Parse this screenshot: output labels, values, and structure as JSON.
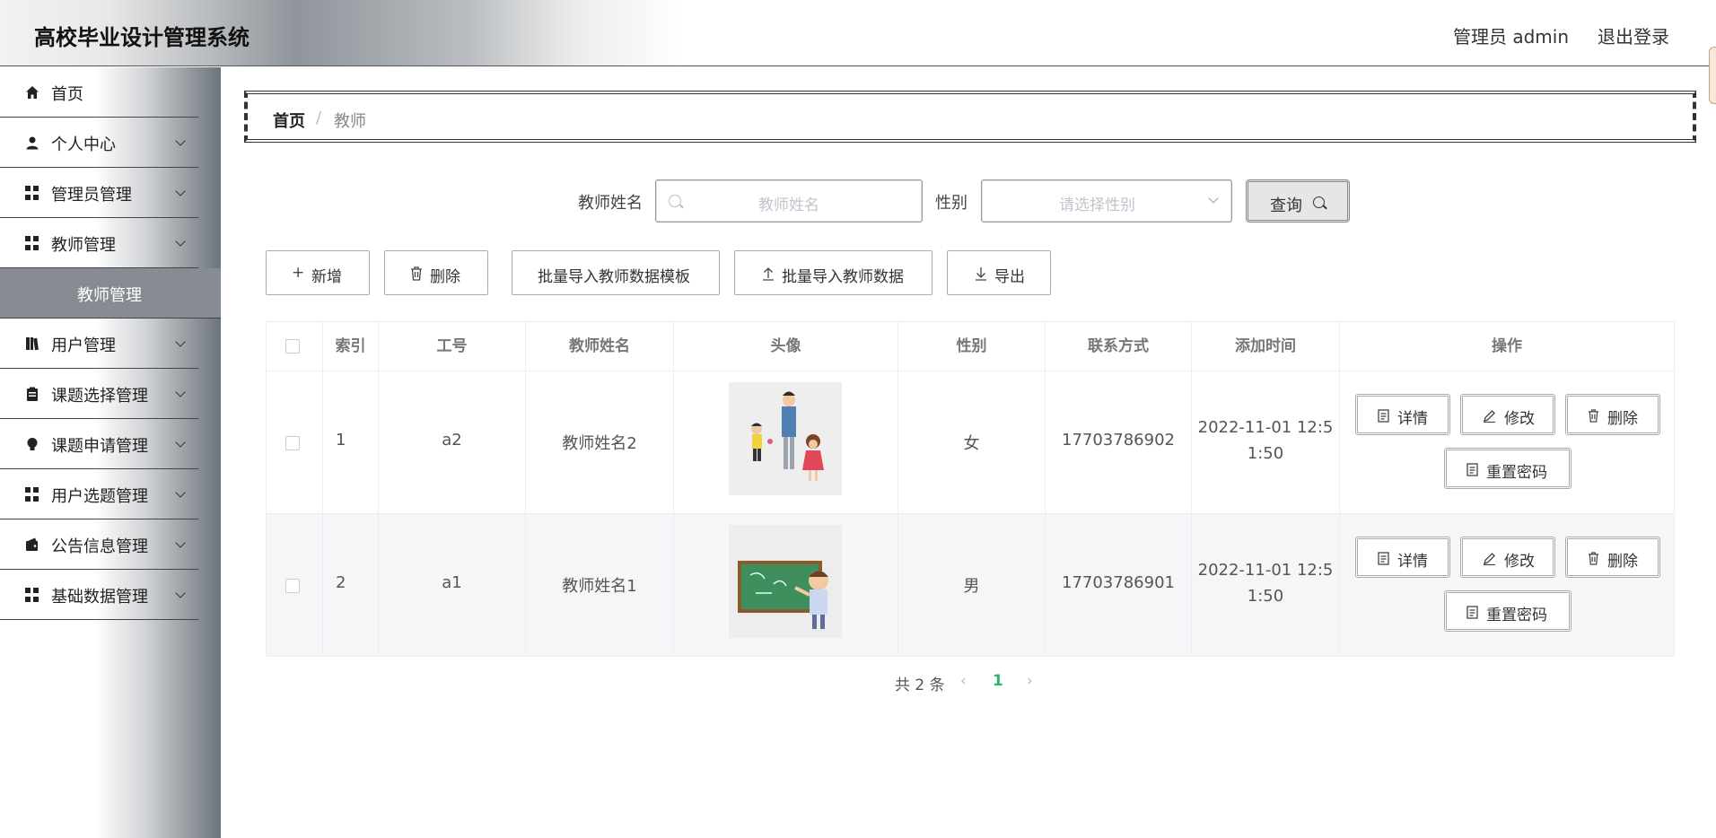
{
  "header": {
    "app_title": "高校毕业设计管理系统",
    "user_label": "管理员 admin",
    "logout_label": "退出登录"
  },
  "sidebar": {
    "items": [
      {
        "label": "首页",
        "icon": "home-icon"
      },
      {
        "label": "个人中心",
        "icon": "user-icon"
      },
      {
        "label": "管理员管理",
        "icon": "grid-icon"
      },
      {
        "label": "教师管理",
        "icon": "grid-icon"
      },
      {
        "label": "用户管理",
        "icon": "book-icon"
      },
      {
        "label": "课题选择管理",
        "icon": "clipboard-icon"
      },
      {
        "label": "课题申请管理",
        "icon": "bulb-icon"
      },
      {
        "label": "用户选题管理",
        "icon": "grid-icon"
      },
      {
        "label": "公告信息管理",
        "icon": "wallet-icon"
      },
      {
        "label": "基础数据管理",
        "icon": "grid-icon"
      }
    ],
    "active_submenu": "教师管理"
  },
  "breadcrumb": {
    "home": "首页",
    "separator": "/",
    "current": "教师"
  },
  "search": {
    "name_label": "教师姓名",
    "name_placeholder": "教师姓名",
    "gender_label": "性别",
    "gender_placeholder": "请选择性别",
    "query_label": "查询"
  },
  "actions": {
    "add": "新增",
    "delete": "删除",
    "template": "批量导入教师数据模板",
    "import": "批量导入教师数据",
    "export": "导出"
  },
  "table": {
    "columns": [
      "索引",
      "工号",
      "教师姓名",
      "头像",
      "性别",
      "联系方式",
      "添加时间",
      "操作"
    ],
    "rows": [
      {
        "index": "1",
        "job_no": "a2",
        "name": "教师姓名2",
        "avatar": "teacher-with-children-image",
        "gender": "女",
        "phone": "17703786902",
        "time_line1": "2022-11-01 12:5",
        "time_line2": "1:50"
      },
      {
        "index": "2",
        "job_no": "a1",
        "name": "教师姓名1",
        "avatar": "teacher-at-blackboard-image",
        "gender": "男",
        "phone": "17703786901",
        "time_line1": "2022-11-01 12:5",
        "time_line2": "1:50"
      }
    ],
    "row_actions": {
      "detail": "详情",
      "edit": "修改",
      "delete": "删除",
      "reset": "重置密码"
    }
  },
  "pagination": {
    "total_label": "共 2 条",
    "current_page": "1"
  },
  "colors": {
    "sidebar_active": "#868c92",
    "page_active": "#2ab573",
    "header_gradient_mid": "#8f959b"
  }
}
